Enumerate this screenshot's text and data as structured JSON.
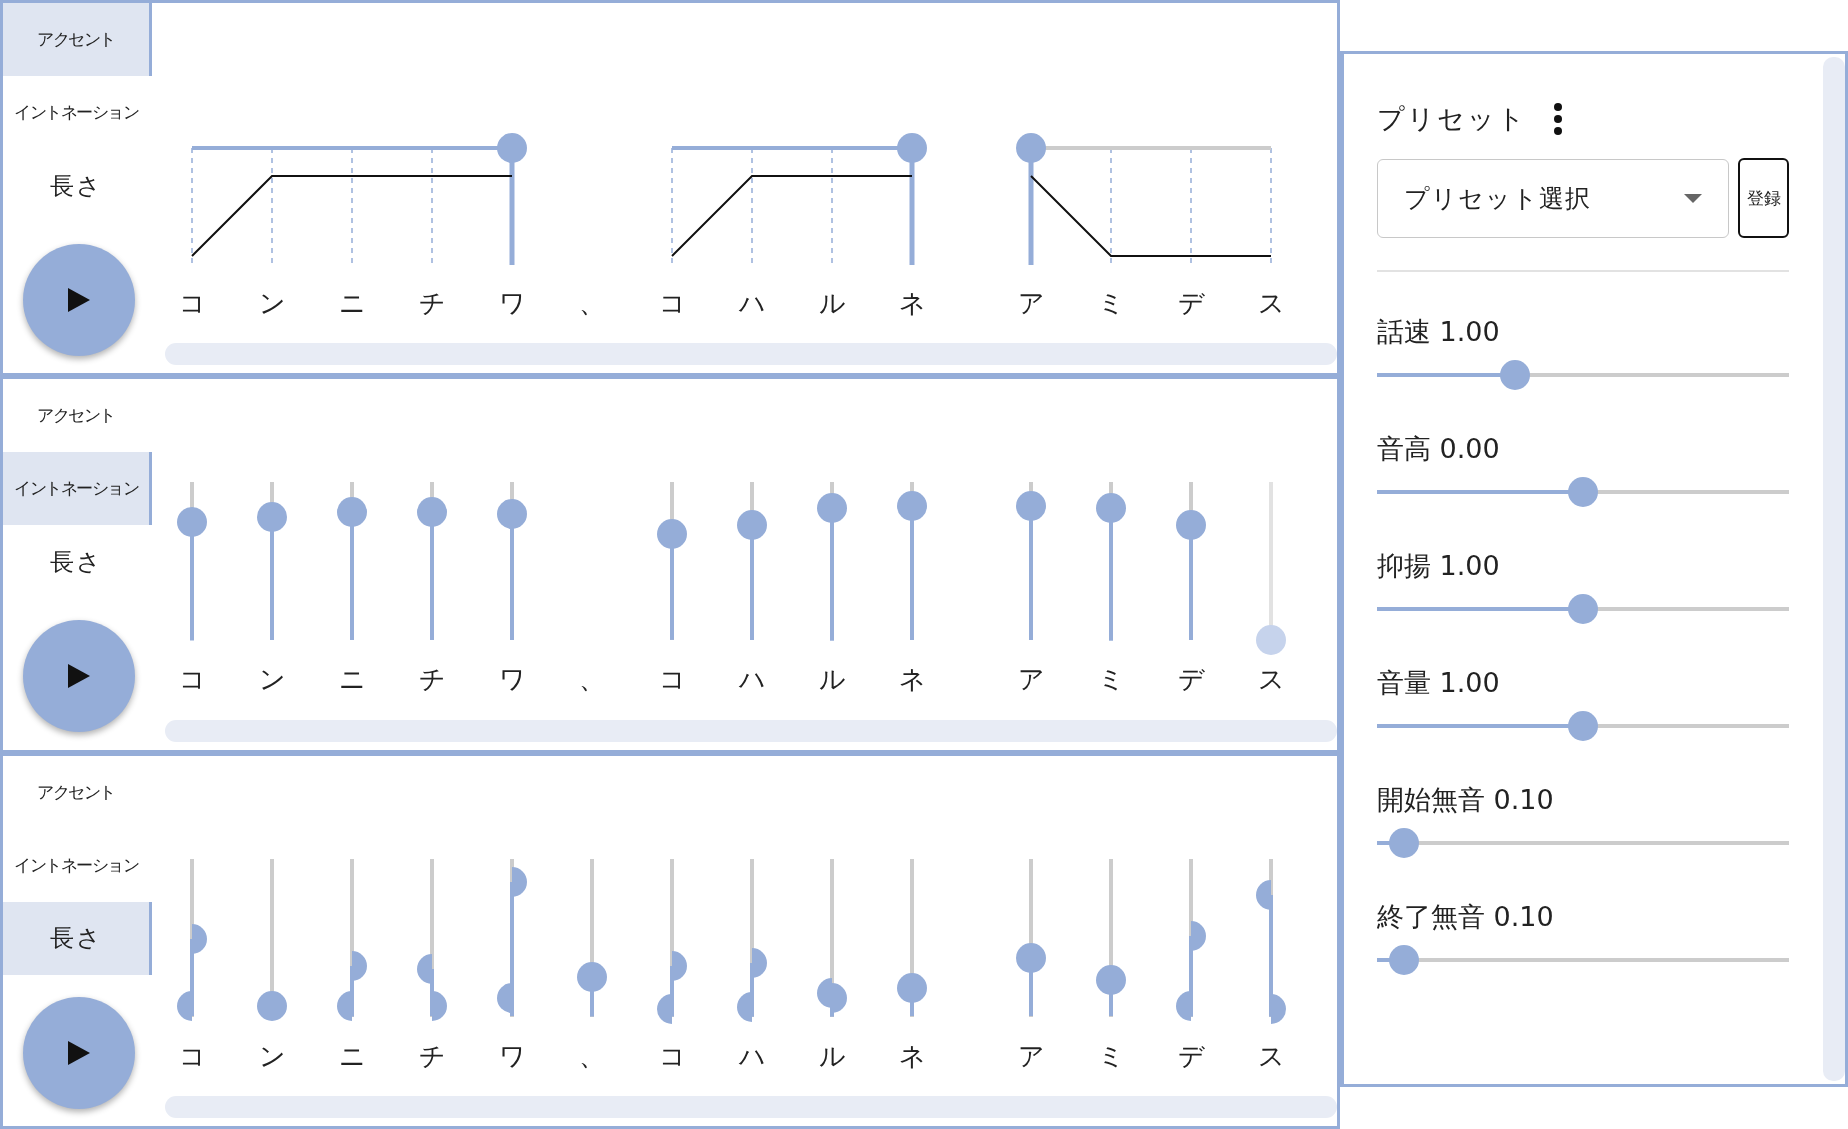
{
  "panels": [
    {
      "kind": "accent",
      "tabs": [
        {
          "label": "アクセント",
          "selected": true
        },
        {
          "label": "イントネーション",
          "selected": false
        },
        {
          "label": "長さ",
          "selected": false
        }
      ],
      "phrases": [
        {
          "level": 1,
          "moras": [
            {
              "text": "コ"
            },
            {
              "text": "ン"
            },
            {
              "text": "ニ"
            },
            {
              "text": "チ"
            },
            {
              "text": "ワ"
            }
          ],
          "pause": {
            "text": "、"
          }
        },
        {
          "level": 1,
          "moras": [
            {
              "text": "コ"
            },
            {
              "text": "ハ"
            },
            {
              "text": "ル"
            },
            {
              "text": "ネ"
            }
          ]
        },
        {
          "level": 0,
          "moras": [
            {
              "text": "ア"
            },
            {
              "text": "ミ"
            },
            {
              "text": "デ"
            },
            {
              "text": "ス"
            }
          ]
        }
      ]
    },
    {
      "kind": "intonation",
      "tabs": [
        {
          "label": "アクセント",
          "selected": false
        },
        {
          "label": "イントネーション",
          "selected": true
        },
        {
          "label": "長さ",
          "selected": false
        }
      ],
      "phrases": [
        {
          "moras": [
            {
              "text": "コ",
              "level": 0.75,
              "disabled": false
            },
            {
              "text": "ン",
              "level": 0.78,
              "disabled": false
            },
            {
              "text": "ニ",
              "level": 0.81,
              "disabled": false
            },
            {
              "text": "チ",
              "level": 0.81,
              "disabled": false
            },
            {
              "text": "ワ",
              "level": 0.8,
              "disabled": false
            }
          ],
          "pause": {
            "text": "、"
          }
        },
        {
          "moras": [
            {
              "text": "コ",
              "level": 0.67,
              "disabled": false
            },
            {
              "text": "ハ",
              "level": 0.73,
              "disabled": false
            },
            {
              "text": "ル",
              "level": 0.84,
              "disabled": false
            },
            {
              "text": "ネ",
              "level": 0.85,
              "disabled": false
            }
          ]
        },
        {
          "moras": [
            {
              "text": "ア",
              "level": 0.85,
              "disabled": false
            },
            {
              "text": "ミ",
              "level": 0.84,
              "disabled": false
            },
            {
              "text": "デ",
              "level": 0.73,
              "disabled": false
            },
            {
              "text": "ス",
              "level": 0,
              "disabled": true
            }
          ]
        }
      ]
    },
    {
      "kind": "length",
      "tabs": [
        {
          "label": "アクセント",
          "selected": false
        },
        {
          "label": "イントネーション",
          "selected": false
        },
        {
          "label": "長さ",
          "selected": true
        }
      ],
      "phrases": [
        {
          "moras": [
            {
              "text": "コ",
              "kind": "pair",
              "consonant": {
                "level": 0.07
              },
              "vowel": {
                "level": 0.49
              }
            },
            {
              "text": "ン",
              "kind": "single",
              "level": 0.07
            },
            {
              "text": "ニ",
              "kind": "pair",
              "consonant": {
                "level": 0.07
              },
              "vowel": {
                "level": 0.32
              }
            },
            {
              "text": "チ",
              "kind": "pair",
              "consonant": {
                "level": 0.3
              },
              "vowel": {
                "level": 0.07
              }
            },
            {
              "text": "ワ",
              "kind": "pair",
              "consonant": {
                "level": 0.12
              },
              "vowel": {
                "level": 0.85
              }
            }
          ],
          "pause": {
            "text": "、",
            "level": 0.25
          }
        },
        {
          "moras": [
            {
              "text": "コ",
              "kind": "pair",
              "consonant": {
                "level": 0.05
              },
              "vowel": {
                "level": 0.32
              }
            },
            {
              "text": "ハ",
              "kind": "pair",
              "consonant": {
                "level": 0.06
              },
              "vowel": {
                "level": 0.34
              }
            },
            {
              "text": "ル",
              "kind": "pair",
              "consonant": {
                "level": 0.15
              },
              "vowel": {
                "level": 0.12
              }
            },
            {
              "text": "ネ",
              "kind": "single",
              "level": 0.18
            }
          ]
        },
        {
          "moras": [
            {
              "text": "ア",
              "kind": "single",
              "level": 0.37
            },
            {
              "text": "ミ",
              "kind": "single",
              "level": 0.23
            },
            {
              "text": "デ",
              "kind": "pair",
              "consonant": {
                "level": 0.07
              },
              "vowel": {
                "level": 0.51
              }
            },
            {
              "text": "ス",
              "kind": "pair",
              "consonant": {
                "level": 0.77
              },
              "vowel": {
                "level": 0.05
              }
            }
          ]
        }
      ]
    }
  ],
  "preset": {
    "title": "プリセット",
    "select": {
      "placeholder": "プリセット選択"
    },
    "register_button": "登録"
  },
  "parameters": [
    {
      "label": "話速 1.00",
      "level": 0.335
    },
    {
      "label": "音高 0.00",
      "level": 0.5
    },
    {
      "label": "抑揚 1.00",
      "level": 0.5
    },
    {
      "label": "音量 1.00",
      "level": 0.5
    },
    {
      "label": "開始無音 0.10",
      "level": 0.065
    },
    {
      "label": "終了無音 0.10",
      "level": 0.065
    }
  ]
}
